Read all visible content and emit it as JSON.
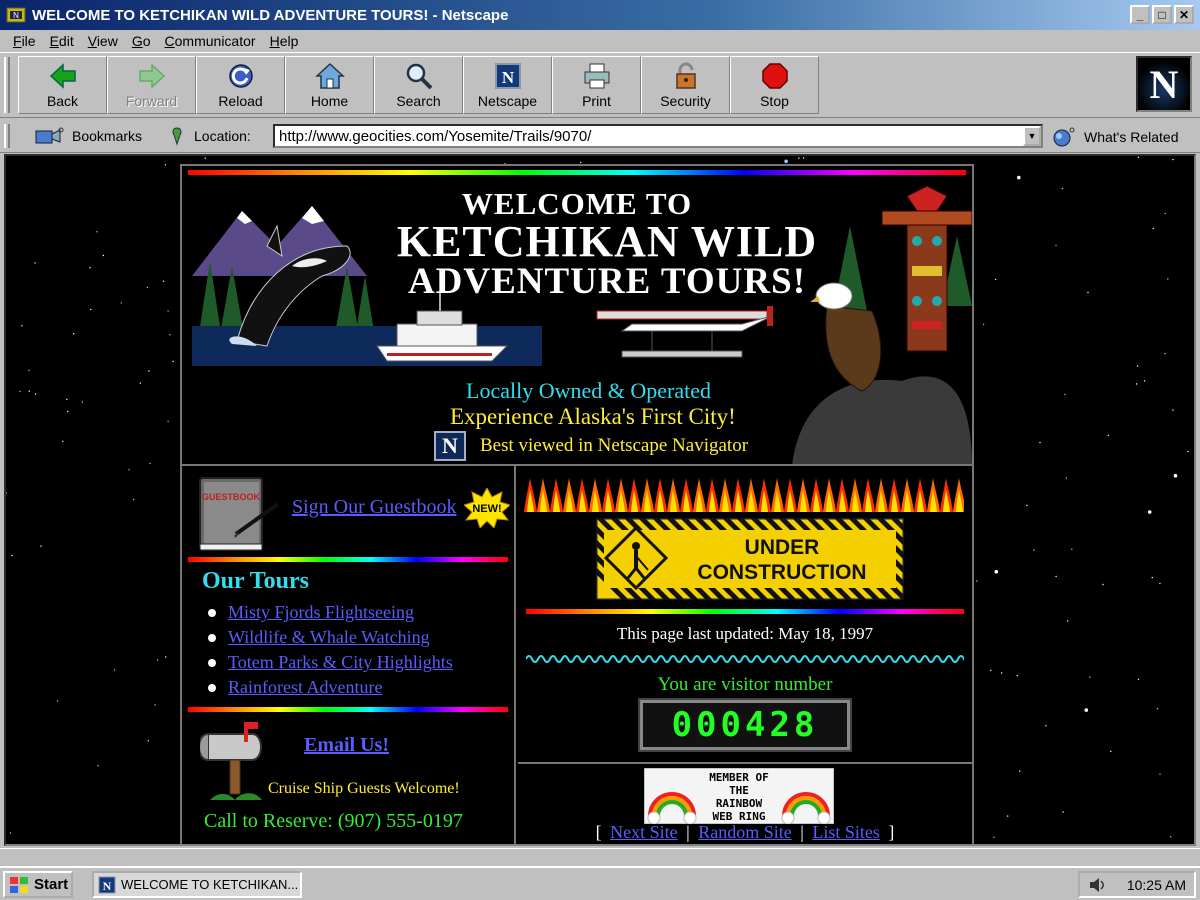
{
  "window": {
    "title": "WELCOME TO KETCHIKAN WILD ADVENTURE TOURS! - Netscape",
    "controls": [
      "_",
      "□",
      "✕"
    ]
  },
  "menu": [
    "File",
    "Edit",
    "View",
    "Go",
    "Communicator",
    "Help"
  ],
  "toolbar": {
    "buttons": [
      {
        "label": "Back",
        "icon": "back-arrow-icon"
      },
      {
        "label": "Forward",
        "icon": "forward-arrow-icon"
      },
      {
        "label": "Reload",
        "icon": "reload-icon"
      },
      {
        "label": "Home",
        "icon": "home-icon"
      },
      {
        "label": "Search",
        "icon": "search-icon"
      },
      {
        "label": "Netscape",
        "icon": "netscape-icon"
      },
      {
        "label": "Print",
        "icon": "printer-icon"
      },
      {
        "label": "Security",
        "icon": "padlock-icon"
      },
      {
        "label": "Stop",
        "icon": "stop-icon"
      }
    ],
    "logo": "N"
  },
  "location": {
    "bookmarks_label": "Bookmarks",
    "location_label": "Location:",
    "url": "http://www.geocities.com/Yosemite/Trails/9070/",
    "related_label": "What's Related"
  },
  "banner": {
    "line1": "WELCOME TO",
    "line2": "KETCHIKAN WILD",
    "line3": "ADVENTURE TOURS!",
    "tagline1": "Locally Owned & Operated",
    "tagline2": "Experience Alaska's First City!",
    "best_viewed": "Best viewed in Netscape Navigator",
    "best_viewed_logo": "N"
  },
  "left": {
    "guestbook_label": "GUESTBOOK",
    "guestbook_link": "Sign Our Guestbook",
    "new_badge": "NEW!",
    "tours_title": "Our Tours",
    "tours": [
      "Misty Fjords Flightseeing",
      "Wildlife & Whale Watching",
      "Totem Parks & City Highlights",
      "Rainforest Adventure"
    ],
    "email_link": "Email Us!",
    "cruise_note": "Cruise Ship Guests Welcome!",
    "call": "Call to Reserve: (907) 555-0197"
  },
  "right": {
    "construction_line1": "UNDER",
    "construction_line2": "CONSTRUCTION",
    "updated": "This page last updated: May 18, 1997",
    "visitor_label": "You are visitor number",
    "visitor_count": "000428",
    "webring_lines": [
      "MEMBER OF",
      "THE",
      "RAINBOW",
      "WEB RING"
    ],
    "ring_links": [
      "Next Site",
      "Random Site",
      "List Sites"
    ]
  },
  "taskbar": {
    "start_label": "Start",
    "task_label": "WELCOME TO KETCHIKAN...",
    "clock": "10:25 AM"
  },
  "colors": {
    "title_gradient_start": "#0a246a",
    "link": "#5b5bff",
    "cyan_text": "#33ddee",
    "yellow_text": "#ffee33",
    "green_text": "#33ee33"
  }
}
